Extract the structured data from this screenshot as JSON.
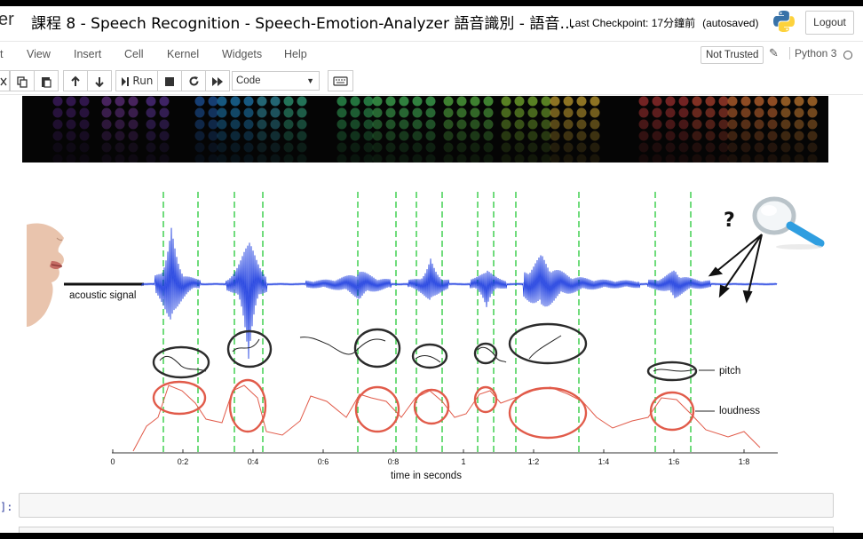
{
  "header": {
    "logo_fragment": "er",
    "notebook_title": "課程 8 - Speech Recognition - Speech-Emotion-Analyzer 語音識別 - 語音…",
    "checkpoint": "Last Checkpoint: 17分鐘前",
    "autosaved": "(autosaved)",
    "logout_label": "Logout"
  },
  "menubar": {
    "items": [
      "t",
      "View",
      "Insert",
      "Cell",
      "Kernel",
      "Widgets",
      "Help"
    ],
    "not_trusted": "Not Trusted",
    "kernel_name": "Python 3"
  },
  "toolbar": {
    "run_label": "Run",
    "cell_type": "Code"
  },
  "figure": {
    "acoustic_label": "acoustic signal",
    "pitch_label": "pitch",
    "loudness_label": "loudness",
    "question_mark": "?",
    "axis_label": "time in seconds",
    "ticks": [
      "0",
      "0:2",
      "0:4",
      "0:6",
      "0:8",
      "1",
      "1:2",
      "1:4",
      "1:6",
      "1:8"
    ]
  },
  "cell": {
    "prompt": "]:"
  },
  "icons": {
    "logo": "python-logo-icon",
    "magnifier": "magnifying-glass-icon",
    "face": "face-mouth-icon"
  }
}
